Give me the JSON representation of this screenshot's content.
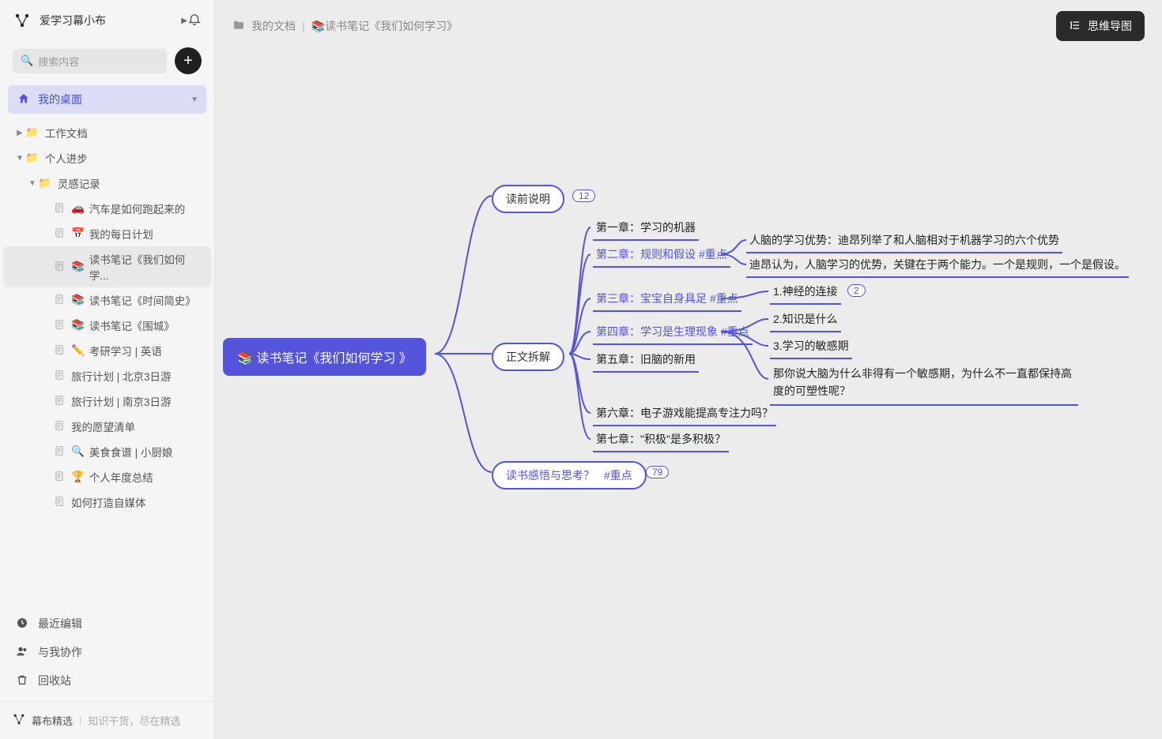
{
  "user": {
    "name": "爱学习幕小布"
  },
  "search": {
    "placeholder": "搜索内容"
  },
  "desktop_label": "我的桌面",
  "tree": {
    "workdocs": "工作文档",
    "personal": "个人进步",
    "inspiration": "灵感记录",
    "items": [
      {
        "emoji": "🚗",
        "label": "汽车是如何跑起来的"
      },
      {
        "emoji": "📅",
        "label": "我的每日计划"
      },
      {
        "emoji": "📚",
        "label": "读书笔记《我们如何学..."
      },
      {
        "emoji": "📚",
        "label": "读书笔记《时间简史》"
      },
      {
        "emoji": "📚",
        "label": "读书笔记《围城》"
      },
      {
        "emoji": "✏️",
        "label": "考研学习 | 英语"
      },
      {
        "emoji": "",
        "label": "旅行计划 | 北京3日游"
      },
      {
        "emoji": "",
        "label": "旅行计划 | 南京3日游"
      },
      {
        "emoji": "",
        "label": "我的愿望清单"
      },
      {
        "emoji": "🔍",
        "label": "美食食谱 | 小厨娘"
      },
      {
        "emoji": "🏆",
        "label": "个人年度总结"
      },
      {
        "emoji": "",
        "label": "如何打造自媒体"
      }
    ]
  },
  "nav": {
    "recent": "最近编辑",
    "collab": "与我协作",
    "trash": "回收站"
  },
  "bottom": {
    "brand": "幕布精选",
    "desc": "知识干货，尽在精选"
  },
  "breadcrumb": {
    "root": "我的文档",
    "current": "📚读书笔记《我们如何学习》"
  },
  "mindmap_btn": "思维导图",
  "mm": {
    "root": "📚 读书笔记《我们如何学习 》",
    "b1": {
      "label": "读前说明",
      "count": "12"
    },
    "b2": {
      "label": "正文拆解"
    },
    "b3": {
      "label": "读书感悟与思考？",
      "tag": "#重点",
      "count": "79"
    },
    "ch1": "第一章：学习的机器",
    "ch2": {
      "label": "第二章：规则和假设",
      "tag": "#重点"
    },
    "ch2a": "人脑的学习优势：迪昂列举了和人脑相对于机器学习的六个优势",
    "ch2b": "迪昂认为，人脑学习的优势，关键在于两个能力。一个是规则，一个是假设。",
    "ch3": {
      "label": "第三章：宝宝自身具足",
      "tag": "#重点"
    },
    "ch3a": "1.神经的连接",
    "ch3a_count": "2",
    "ch3b": "2.知识是什么",
    "ch3c": "3.学习的敏感期",
    "ch3d": "那你说大脑为什么非得有一个敏感期，为什么不一直都保持高度的可塑性呢？",
    "ch4": {
      "label": "第四章：学习是生理现象",
      "tag": "#重点"
    },
    "ch5": "第五章：旧脑的新用",
    "ch6": "第六章：电子游戏能提高专注力吗？",
    "ch7": "第七章：\"积极\"是多积极？"
  }
}
